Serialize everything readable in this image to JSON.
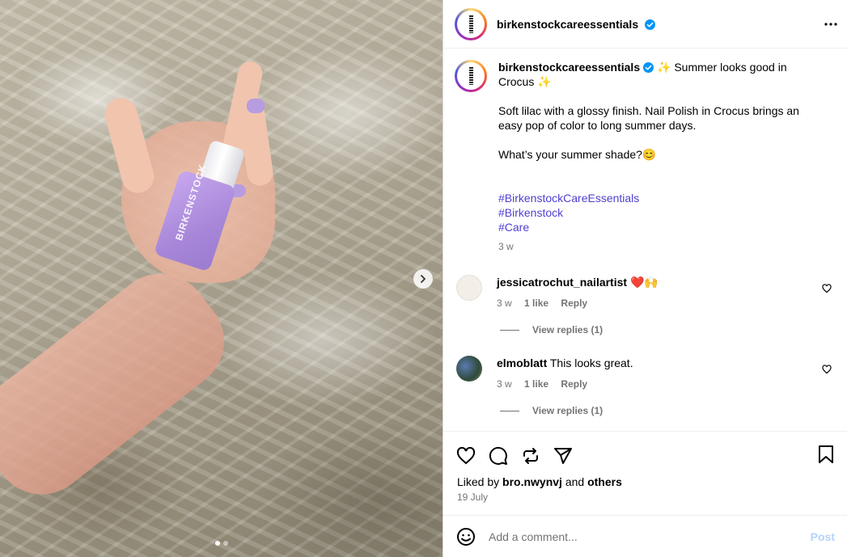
{
  "post": {
    "username": "birkenstockcareessentials",
    "caption_lines": [
      "✨ Summer looks good in Crocus ✨",
      "Soft lilac with a glossy finish. Nail Polish in Crocus brings an easy pop of color to long summer days.",
      "What’s your summer shade?😊"
    ],
    "hashtags": [
      "#BirkenstockCareEssentials",
      "#Birkenstock",
      "#Care"
    ],
    "caption_age": "3 w",
    "image_bottle_text": "BIRKENSTOCK"
  },
  "comments": [
    {
      "username": "jessicatrochut_nailartist",
      "text": "❤️🙌",
      "age": "3 w",
      "likes": "1 like",
      "reply": "Reply",
      "view_replies": "View replies (1)"
    },
    {
      "username": "elmoblatt",
      "text": "This looks great.",
      "age": "3 w",
      "likes": "1 like",
      "reply": "Reply",
      "view_replies": "View replies (1)"
    }
  ],
  "likes": {
    "prefix": "Liked by",
    "user": "bro.nwynvj",
    "and": "and",
    "others": "others"
  },
  "date": "19 July",
  "composer": {
    "placeholder": "Add a comment...",
    "post_label": "Post"
  },
  "colors": {
    "hashtag": "#4e3fd1",
    "verified": "#0095f6",
    "post_button": "#b3d4fc"
  },
  "carousel": {
    "slides": 2,
    "active": 1
  }
}
